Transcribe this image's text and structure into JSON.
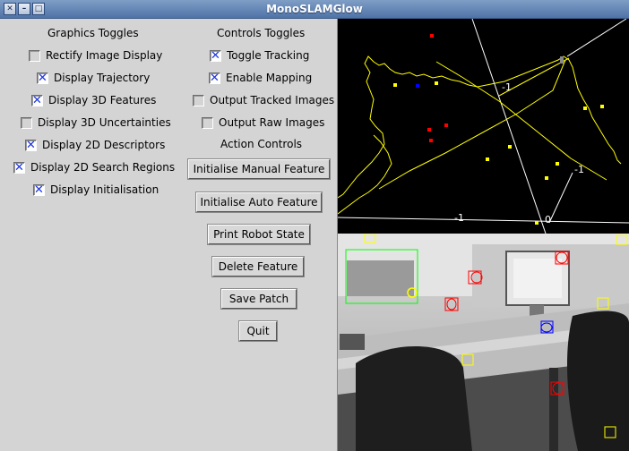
{
  "window": {
    "title": "MonoSLAMGlow"
  },
  "graphics": {
    "heading": "Graphics Toggles",
    "items": [
      {
        "label": "Rectify Image Display",
        "checked": false
      },
      {
        "label": "Display Trajectory",
        "checked": true
      },
      {
        "label": "Display 3D Features",
        "checked": true
      },
      {
        "label": "Display 3D Uncertainties",
        "checked": false
      },
      {
        "label": "Display 2D Descriptors",
        "checked": true
      },
      {
        "label": "Display 2D Search Regions",
        "checked": true
      },
      {
        "label": "Display Initialisation",
        "checked": true
      }
    ]
  },
  "controls": {
    "heading": "Controls Toggles",
    "items": [
      {
        "label": "Toggle Tracking",
        "checked": true
      },
      {
        "label": "Enable Mapping",
        "checked": true
      },
      {
        "label": "Output Tracked Images",
        "checked": false
      },
      {
        "label": "Output Raw Images",
        "checked": false
      }
    ]
  },
  "actions": {
    "heading": "Action Controls",
    "buttons": [
      "Initialise Manual Feature",
      "Initialise Auto Feature",
      "Print Robot State",
      "Delete Feature",
      "Save Patch",
      "Quit"
    ]
  },
  "map_view": {
    "axis_labels": [
      "-1",
      "-1",
      "-1",
      "0"
    ],
    "colors": {
      "trajectory": "#ffff00",
      "feature_selected": "#ff0000",
      "feature_predicted": "#0000ff",
      "feature": "#ffff00",
      "axes": "#ffffff"
    }
  },
  "camera_view": {
    "colors": {
      "search_region": "#00ff00",
      "match_tracked": "#ff0000",
      "match_new": "#ffff00",
      "match_init": "#0000ff"
    }
  }
}
